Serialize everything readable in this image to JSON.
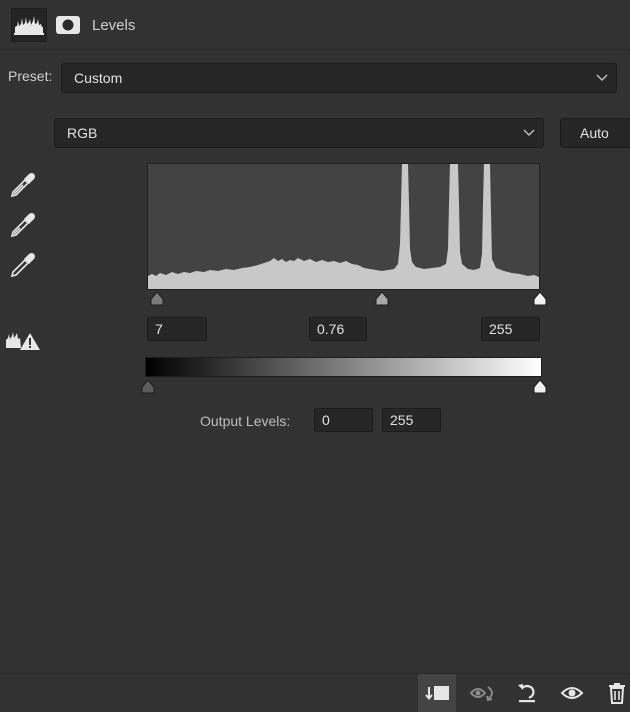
{
  "panel": {
    "title": "Levels",
    "tabs": [
      {
        "icon": "levels-histogram-icon",
        "active": true
      },
      {
        "icon": "mask-icon",
        "active": false
      }
    ]
  },
  "preset": {
    "label": "Preset:",
    "value": "Custom"
  },
  "channel": {
    "value": "RGB",
    "auto_label": "Auto"
  },
  "eyedroppers": [
    {
      "icon": "black-point-eyedropper-icon"
    },
    {
      "icon": "gray-point-eyedropper-icon"
    },
    {
      "icon": "white-point-eyedropper-icon"
    }
  ],
  "clipping_warning_icon": "clipping-warning-icon",
  "input_levels": {
    "black": "7",
    "gamma": "0.76",
    "white": "255"
  },
  "output_levels": {
    "label": "Output Levels:",
    "black": "0",
    "white": "255"
  },
  "toolbar": {
    "buttons": [
      {
        "icon": "clip-to-layer-icon",
        "pressed": true
      },
      {
        "icon": "view-previous-state-icon",
        "pressed": false
      },
      {
        "icon": "reset-icon",
        "pressed": false
      },
      {
        "icon": "toggle-visibility-icon",
        "pressed": false
      },
      {
        "icon": "delete-icon",
        "pressed": false
      }
    ]
  },
  "colors": {
    "panel_bg": "#323232",
    "field_bg": "#262626",
    "histogram_bg": "#434343",
    "histogram_fill": "#c8c8c8"
  }
}
